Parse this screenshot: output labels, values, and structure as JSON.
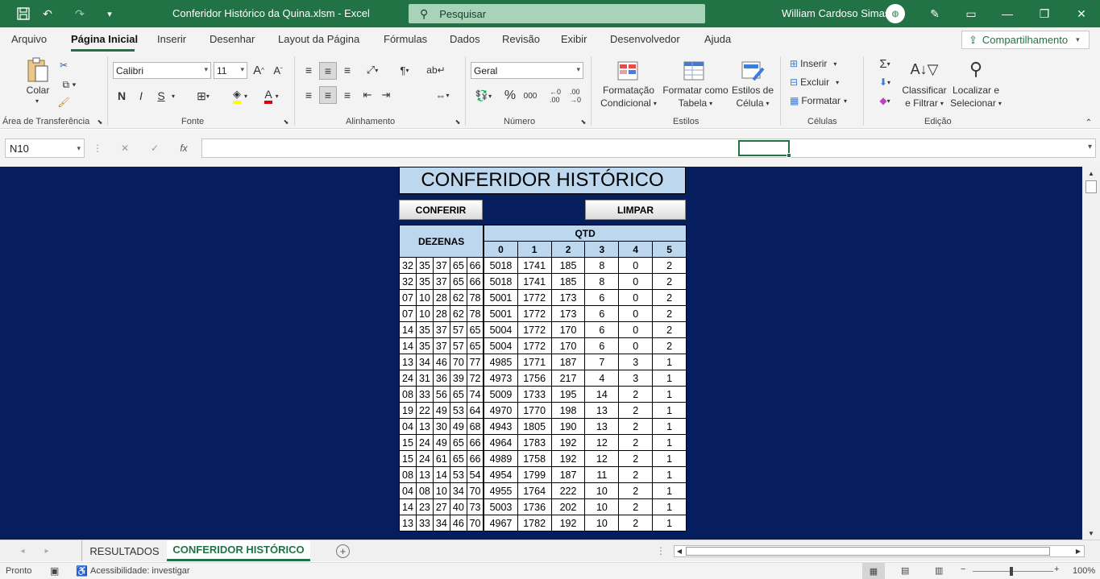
{
  "titlebar": {
    "doc_title": "Conferidor Histórico da Quina.xlsm  -  Excel",
    "search_placeholder": "Pesquisar",
    "user": "William Cardoso Simas"
  },
  "menu": [
    "Arquivo",
    "Página Inicial",
    "Inserir",
    "Desenhar",
    "Layout da Página",
    "Fórmulas",
    "Dados",
    "Revisão",
    "Exibir",
    "Desenvolvedor",
    "Ajuda"
  ],
  "share_label": "Compartilhamento",
  "ribbon": {
    "paste": "Colar",
    "font_name": "Calibri",
    "font_size": "11",
    "bold": "N",
    "italic": "I",
    "underline": "S",
    "number_format": "Geral",
    "cond_format_1": "Formatação",
    "cond_format_2": "Condicional",
    "format_table_1": "Formatar como",
    "format_table_2": "Tabela",
    "cell_styles_1": "Estilos de",
    "cell_styles_2": "Célula",
    "insert": "Inserir",
    "delete": "Excluir",
    "format": "Formatar",
    "sort_1": "Classificar",
    "sort_2": "e Filtrar",
    "find_1": "Localizar e",
    "find_2": "Selecionar",
    "groups": [
      "Área de Transferência",
      "Fonte",
      "Alinhamento",
      "Número",
      "Estilos",
      "Células",
      "Edição"
    ]
  },
  "formula_bar": {
    "name_box": "N10",
    "fx": "fx"
  },
  "sheet": {
    "banner": "CONFERIDOR HISTÓRICO",
    "btn_conferir": "CONFERIR",
    "btn_limpar": "LIMPAR",
    "h_dezenas": "DEZENAS",
    "h_qtd": "QTD",
    "qtd_cols": [
      "0",
      "1",
      "2",
      "3",
      "4",
      "5"
    ],
    "rows": [
      {
        "d": [
          "32",
          "35",
          "37",
          "65",
          "66"
        ],
        "q": [
          "5018",
          "1741",
          "185",
          "8",
          "0",
          "2"
        ]
      },
      {
        "d": [
          "32",
          "35",
          "37",
          "65",
          "66"
        ],
        "q": [
          "5018",
          "1741",
          "185",
          "8",
          "0",
          "2"
        ]
      },
      {
        "d": [
          "07",
          "10",
          "28",
          "62",
          "78"
        ],
        "q": [
          "5001",
          "1772",
          "173",
          "6",
          "0",
          "2"
        ]
      },
      {
        "d": [
          "07",
          "10",
          "28",
          "62",
          "78"
        ],
        "q": [
          "5001",
          "1772",
          "173",
          "6",
          "0",
          "2"
        ]
      },
      {
        "d": [
          "14",
          "35",
          "37",
          "57",
          "65"
        ],
        "q": [
          "5004",
          "1772",
          "170",
          "6",
          "0",
          "2"
        ]
      },
      {
        "d": [
          "14",
          "35",
          "37",
          "57",
          "65"
        ],
        "q": [
          "5004",
          "1772",
          "170",
          "6",
          "0",
          "2"
        ]
      },
      {
        "d": [
          "13",
          "34",
          "46",
          "70",
          "77"
        ],
        "q": [
          "4985",
          "1771",
          "187",
          "7",
          "3",
          "1"
        ]
      },
      {
        "d": [
          "24",
          "31",
          "36",
          "39",
          "72"
        ],
        "q": [
          "4973",
          "1756",
          "217",
          "4",
          "3",
          "1"
        ]
      },
      {
        "d": [
          "08",
          "33",
          "56",
          "65",
          "74"
        ],
        "q": [
          "5009",
          "1733",
          "195",
          "14",
          "2",
          "1"
        ]
      },
      {
        "d": [
          "19",
          "22",
          "49",
          "53",
          "64"
        ],
        "q": [
          "4970",
          "1770",
          "198",
          "13",
          "2",
          "1"
        ]
      },
      {
        "d": [
          "04",
          "13",
          "30",
          "49",
          "68"
        ],
        "q": [
          "4943",
          "1805",
          "190",
          "13",
          "2",
          "1"
        ]
      },
      {
        "d": [
          "15",
          "24",
          "49",
          "65",
          "66"
        ],
        "q": [
          "4964",
          "1783",
          "192",
          "12",
          "2",
          "1"
        ]
      },
      {
        "d": [
          "15",
          "24",
          "61",
          "65",
          "66"
        ],
        "q": [
          "4989",
          "1758",
          "192",
          "12",
          "2",
          "1"
        ]
      },
      {
        "d": [
          "08",
          "13",
          "14",
          "53",
          "54"
        ],
        "q": [
          "4954",
          "1799",
          "187",
          "11",
          "2",
          "1"
        ]
      },
      {
        "d": [
          "04",
          "08",
          "10",
          "34",
          "70"
        ],
        "q": [
          "4955",
          "1764",
          "222",
          "10",
          "2",
          "1"
        ]
      },
      {
        "d": [
          "14",
          "23",
          "27",
          "40",
          "73"
        ],
        "q": [
          "5003",
          "1736",
          "202",
          "10",
          "2",
          "1"
        ]
      },
      {
        "d": [
          "13",
          "33",
          "34",
          "46",
          "70"
        ],
        "q": [
          "4967",
          "1782",
          "192",
          "10",
          "2",
          "1"
        ]
      }
    ]
  },
  "sheet_tabs": [
    "RESULTADOS",
    "CONFERIDOR HISTÓRICO"
  ],
  "status": {
    "ready": "Pronto",
    "accessibility": "Acessibilidade: investigar",
    "zoom": "100%"
  },
  "colors": {
    "excel_green": "#217346",
    "sheet_bg": "#061e5e",
    "header_blue": "#bdd7ee"
  }
}
